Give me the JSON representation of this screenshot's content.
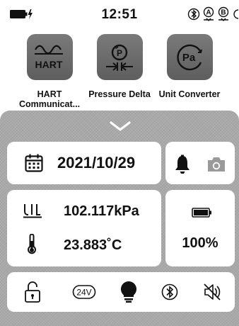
{
  "status_bar": {
    "time": "12:51",
    "icons": [
      "battery-charging-icon",
      "bluetooth-icon",
      "a-marker-icon",
      "b-marker-icon",
      "refresh-icon"
    ],
    "a_label": "A",
    "b_label": "B"
  },
  "apps": [
    {
      "label": "HART Communicat...",
      "icon": "hart-wave-icon",
      "tile_text": "HART"
    },
    {
      "label": "Pressure Delta",
      "icon": "pressure-delta-icon",
      "tile_text": "P"
    },
    {
      "label": "Unit Converter",
      "icon": "unit-converter-icon",
      "tile_text": "Pa"
    }
  ],
  "panel": {
    "date": "2021/10/29",
    "pressure": "102.117kPa",
    "temperature": "23.883˚C",
    "battery_percent": "100%",
    "battery_level": 1.0,
    "toggle_24v": "24V",
    "icons": [
      "chevron-down-icon",
      "calendar-icon",
      "bell-icon",
      "camera-icon",
      "pressure-gauge-icon",
      "thermometer-icon",
      "battery-icon",
      "unlock-icon",
      "power-24v-icon",
      "bulb-icon",
      "bluetooth-icon",
      "mute-icon"
    ]
  },
  "colors": {
    "panel_bg": "#a9a9a9",
    "card_bg": "#ffffff",
    "tile_bg": "#6b6b6b",
    "text": "#111111",
    "muted_icon": "#9a9a9a"
  }
}
